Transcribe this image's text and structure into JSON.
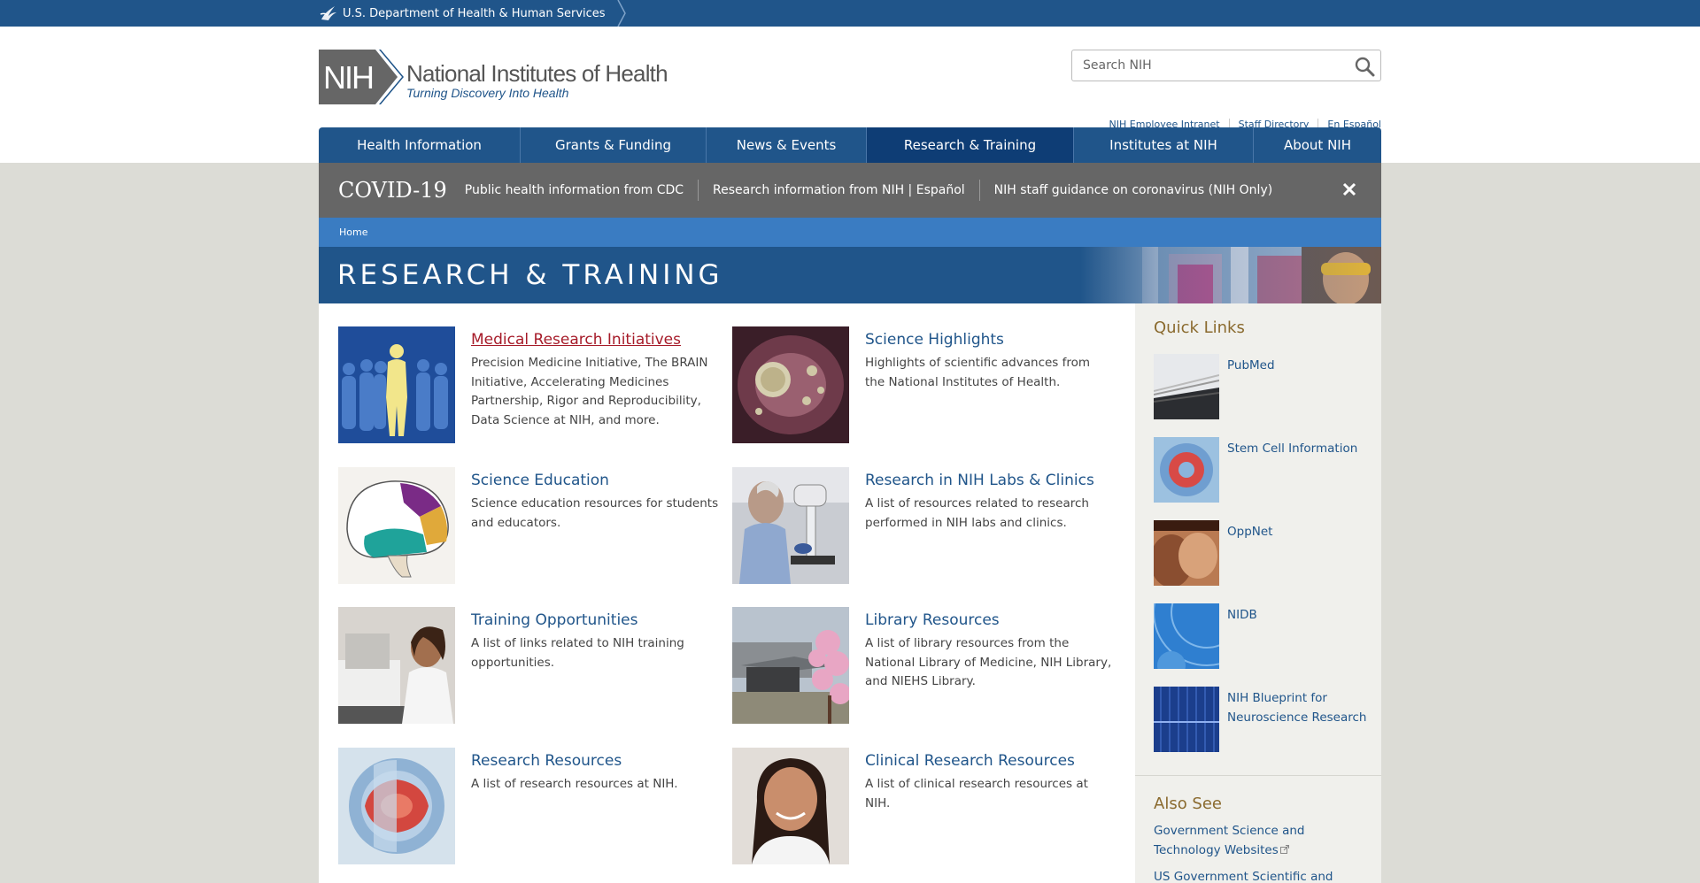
{
  "hhs_bar": {
    "label": "U.S. Department of Health & Human Services"
  },
  "header": {
    "logo_abbr": "NIH",
    "logo_title": "National Institutes of Health",
    "logo_tagline": "Turning Discovery Into Health",
    "search_placeholder": "Search NIH",
    "util_links": [
      "NIH Employee Intranet",
      "Staff Directory",
      "En Español"
    ]
  },
  "nav": {
    "items": [
      "Health Information",
      "Grants & Funding",
      "News & Events",
      "Research & Training",
      "Institutes at NIH",
      "About NIH"
    ],
    "active": "Research & Training"
  },
  "covid": {
    "title": "COVID-19",
    "links": [
      "Public health information from CDC",
      "Research information from NIH | Español",
      "NIH staff guidance on coronavirus (NIH Only)"
    ]
  },
  "breadcrumb": {
    "home": "Home"
  },
  "page_title": "RESEARCH & TRAINING",
  "cards": [
    {
      "title": "Medical Research Initiatives",
      "desc": "Precision Medicine Initiative, The BRAIN Initiative, Accelerating Medicines Partnership, Rigor and Reproducibility, Data Science at NIH, and more.",
      "visited": true
    },
    {
      "title": "Science Highlights",
      "desc": "Highlights of scientific advances from the National Institutes of Health."
    },
    {
      "title": "Science Education",
      "desc": "Science education resources for students and educators."
    },
    {
      "title": "Research in NIH Labs & Clinics",
      "desc": "A list of resources related to research performed in NIH labs and clinics."
    },
    {
      "title": "Training Opportunities",
      "desc": "A list of links related to NIH training opportunities."
    },
    {
      "title": "Library Resources",
      "desc": "A list of library resources from the National Library of Medicine, NIH Library, and NIEHS Library."
    },
    {
      "title": "Research Resources",
      "desc": "A list of research resources at NIH."
    },
    {
      "title": "Clinical Research Resources",
      "desc": "A list of clinical research resources at NIH."
    }
  ],
  "sidebar": {
    "quick_links_title": "Quick Links",
    "quick_links": [
      "PubMed",
      "Stem Cell Information",
      "OppNet",
      "NIDB",
      "NIH Blueprint for Neuroscience Research"
    ],
    "also_see_title": "Also See",
    "also_see": [
      "Government Science and Technology Websites",
      "US Government Scientific and"
    ]
  },
  "colors": {
    "nih_blue": "#20558a",
    "nav_active": "#0e3d75",
    "covid_gray": "#666666",
    "crumb_blue": "#3a7cc2",
    "visited_red": "#a61b29",
    "sidebar_heading": "#8a6a2e"
  }
}
